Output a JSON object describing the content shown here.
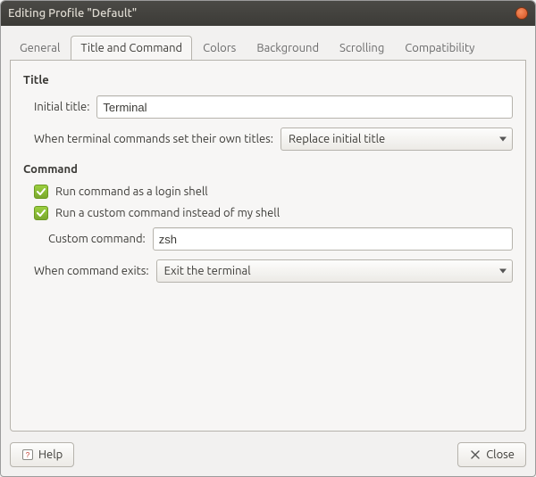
{
  "window": {
    "title": "Editing Profile \"Default\""
  },
  "tabs": [
    {
      "label": "General"
    },
    {
      "label": "Title and Command"
    },
    {
      "label": "Colors"
    },
    {
      "label": "Background"
    },
    {
      "label": "Scrolling"
    },
    {
      "label": "Compatibility"
    }
  ],
  "active_tab": 1,
  "title_section": {
    "heading": "Title",
    "initial_title_label": "Initial title:",
    "initial_title_value": "Terminal",
    "set_titles_label": "When terminal commands set their own titles:",
    "set_titles_value": "Replace initial title"
  },
  "command_section": {
    "heading": "Command",
    "login_shell_label": "Run command as a login shell",
    "login_shell_checked": true,
    "custom_command_checkbox_label": "Run a custom command instead of my shell",
    "custom_command_checked": true,
    "custom_command_label": "Custom command:",
    "custom_command_value": "zsh",
    "when_exits_label": "When command exits:",
    "when_exits_value": "Exit the terminal"
  },
  "buttons": {
    "help": "Help",
    "close": "Close"
  }
}
